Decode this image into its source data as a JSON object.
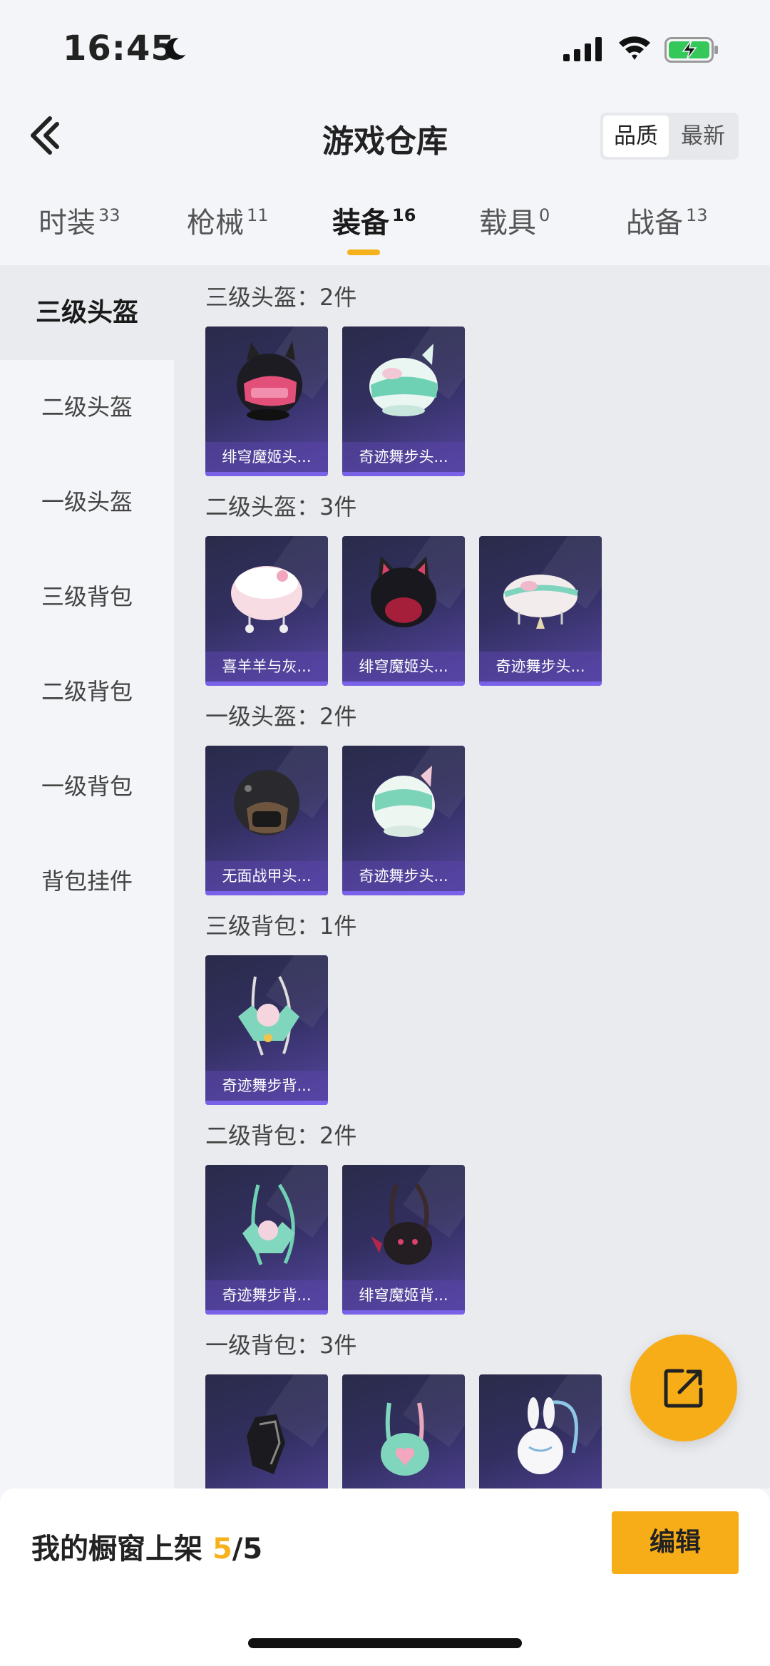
{
  "status_bar": {
    "time": "16:45"
  },
  "header": {
    "title": "游戏仓库",
    "sort_options": [
      "品质",
      "最新"
    ],
    "sort_selected": "品质"
  },
  "tabs": [
    {
      "label": "时装",
      "count": "33"
    },
    {
      "label": "枪械",
      "count": "11"
    },
    {
      "label": "装备",
      "count": "16",
      "active": true
    },
    {
      "label": "载具",
      "count": "0"
    },
    {
      "label": "战备",
      "count": "13"
    }
  ],
  "sidebar": {
    "items": [
      "三级头盔",
      "二级头盔",
      "一级头盔",
      "三级背包",
      "二级背包",
      "一级背包",
      "背包挂件"
    ],
    "active": "三级头盔"
  },
  "sections": [
    {
      "title": "三级头盔：2件",
      "items": [
        {
          "name": "绯穹魔姬头...",
          "icon": "black-pink-cat-helmet-icon"
        },
        {
          "name": "奇迹舞步头...",
          "icon": "mint-cat-helmet-icon"
        }
      ]
    },
    {
      "title": "二级头盔：3件",
      "items": [
        {
          "name": "喜羊羊与灰...",
          "icon": "pink-sheep-helmet-icon"
        },
        {
          "name": "绯穹魔姬头...",
          "icon": "black-cat-helmet-icon"
        },
        {
          "name": "奇迹舞步头...",
          "icon": "mint-cat-helmet-icon"
        }
      ]
    },
    {
      "title": "一级头盔：2件",
      "items": [
        {
          "name": "无面战甲头...",
          "icon": "black-motor-helmet-icon"
        },
        {
          "name": "奇迹舞步头...",
          "icon": "mint-cat-helmet-icon"
        }
      ]
    },
    {
      "title": "三级背包：1件",
      "items": [
        {
          "name": "奇迹舞步背...",
          "icon": "mint-fairy-backpack-icon"
        }
      ]
    },
    {
      "title": "二级背包：2件",
      "items": [
        {
          "name": "奇迹舞步背...",
          "icon": "mint-fairy-backpack-icon"
        },
        {
          "name": "绯穹魔姬背...",
          "icon": "black-cat-backpack-icon"
        }
      ]
    },
    {
      "title": "一级背包：3件",
      "items": [
        {
          "name": "",
          "icon": "black-pack-icon"
        },
        {
          "name": "",
          "icon": "mint-heart-backpack-icon"
        },
        {
          "name": "",
          "icon": "white-bunny-backpack-icon"
        }
      ]
    }
  ],
  "bottom_bar": {
    "showcase_label": "我的橱窗上架",
    "showcase_current": "5",
    "showcase_total": "/5",
    "edit_label": "编辑"
  },
  "colors": {
    "accent": "#f7ad18",
    "card_bg": "#322f60",
    "card_bar": "#7a62e8"
  }
}
